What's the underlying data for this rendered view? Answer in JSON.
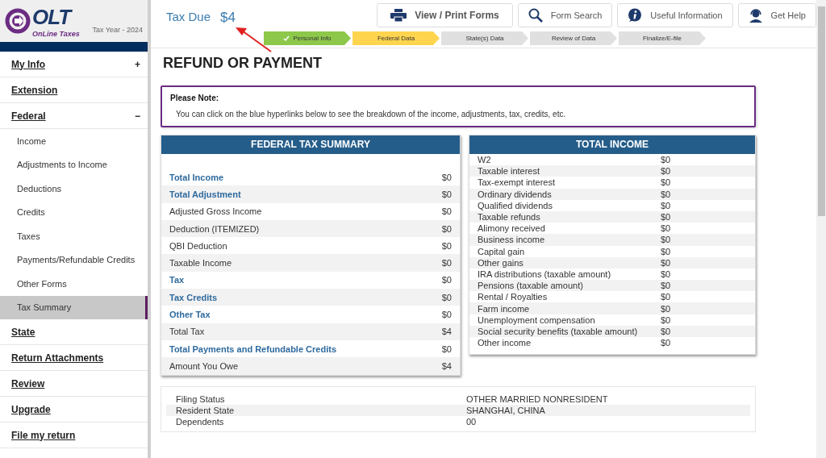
{
  "logo": {
    "mark": "OLT",
    "tagline": "OnLine Taxes"
  },
  "tax_year": "Tax Year - 2024",
  "sidebar": {
    "items": [
      {
        "label": "My Info",
        "toggle": "+",
        "selected": false
      },
      {
        "label": "Extension",
        "selected": false
      },
      {
        "label": "Federal",
        "toggle": "−",
        "selected": false,
        "children": [
          {
            "label": "Income",
            "selected": false
          },
          {
            "label": "Adjustments to Income",
            "selected": false
          },
          {
            "label": "Deductions",
            "selected": false
          },
          {
            "label": "Credits",
            "selected": false
          },
          {
            "label": "Taxes",
            "selected": false
          },
          {
            "label": "Payments/Refundable Credits",
            "selected": false
          },
          {
            "label": "Other Forms",
            "selected": false
          },
          {
            "label": "Tax Summary",
            "selected": true
          }
        ]
      },
      {
        "label": "State",
        "selected": false
      },
      {
        "label": "Return Attachments",
        "selected": false
      },
      {
        "label": "Review",
        "selected": false
      },
      {
        "label": "Upgrade",
        "selected": false
      },
      {
        "label": "File my return",
        "selected": false
      }
    ]
  },
  "tax_due": {
    "label": "Tax Due",
    "amount": "$4"
  },
  "toolbar": [
    {
      "label": "View / Print Forms",
      "kind": "printer",
      "primary": true
    },
    {
      "label": "Form Search",
      "kind": "search",
      "primary": false
    },
    {
      "label": "Useful Information",
      "kind": "info",
      "primary": false
    },
    {
      "label": "Get Help",
      "kind": "help",
      "primary": false
    }
  ],
  "steps": [
    {
      "label": "Personal Info",
      "kind": "done"
    },
    {
      "label": "Federal Data",
      "kind": "current"
    },
    {
      "label": "State(s) Data",
      "kind": "pending"
    },
    {
      "label": "Review of Data",
      "kind": "pending"
    },
    {
      "label": "Finalize/E-file",
      "kind": "pending"
    }
  ],
  "page_title": "REFUND OR PAYMENT",
  "note": {
    "title": "Please Note:",
    "text": "You can click on the blue hyperlinks below to see the breakdown of the income, adjustments, tax, credits, etc."
  },
  "federal_summary": {
    "title": "FEDERAL TAX SUMMARY",
    "rows": [
      {
        "label": "Total Income",
        "value": "$0",
        "link": true
      },
      {
        "label": "Total Adjustment",
        "value": "$0",
        "link": true
      },
      {
        "label": "Adjusted Gross Income",
        "value": "$0",
        "link": false
      },
      {
        "label": "Deduction (ITEMIZED)",
        "value": "$0",
        "link": false
      },
      {
        "label": "QBI Deduction",
        "value": "$0",
        "link": false
      },
      {
        "label": "Taxable Income",
        "value": "$0",
        "link": false
      },
      {
        "label": "Tax",
        "value": "$0",
        "link": true
      },
      {
        "label": "Tax Credits",
        "value": "$0",
        "link": true
      },
      {
        "label": "Other Tax",
        "value": "$0",
        "link": true
      },
      {
        "label": "Total Tax",
        "value": "$4",
        "link": false
      },
      {
        "label": "Total Payments and Refundable Credits",
        "value": "$0",
        "link": true
      },
      {
        "label": "Amount You Owe",
        "value": "$4",
        "link": false
      }
    ]
  },
  "total_income": {
    "title": "TOTAL INCOME",
    "rows": [
      {
        "label": "W2",
        "value": "$0"
      },
      {
        "label": "Taxable interest",
        "value": "$0"
      },
      {
        "label": "Tax-exempt interest",
        "value": "$0"
      },
      {
        "label": "Ordinary dividends",
        "value": "$0"
      },
      {
        "label": "Qualified dividends",
        "value": "$0"
      },
      {
        "label": "Taxable refunds",
        "value": "$0"
      },
      {
        "label": "Alimony received",
        "value": "$0"
      },
      {
        "label": "Business income",
        "value": "$0"
      },
      {
        "label": "Capital gain",
        "value": "$0"
      },
      {
        "label": "Other gains",
        "value": "$0"
      },
      {
        "label": "IRA distributions (taxable amount)",
        "value": "$0"
      },
      {
        "label": "Pensions (taxable amount)",
        "value": "$0"
      },
      {
        "label": "Rental / Royalties",
        "value": "$0"
      },
      {
        "label": "Farm income",
        "value": "$0"
      },
      {
        "label": "Unemployment compensation",
        "value": "$0"
      },
      {
        "label": "Social security benefits (taxable amount)",
        "value": "$0"
      },
      {
        "label": "Other income",
        "value": "$0"
      }
    ]
  },
  "filing_info": [
    {
      "label": "Filing Status",
      "value": "OTHER MARRIED NONRESIDENT"
    },
    {
      "label": "Resident State",
      "value": "SHANGHAI, CHINA"
    },
    {
      "label": "Dependents",
      "value": "00"
    }
  ]
}
